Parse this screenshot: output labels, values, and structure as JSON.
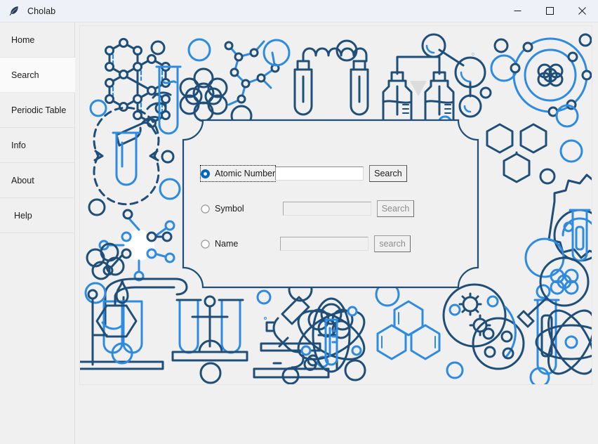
{
  "window": {
    "title": "Cholab",
    "app_icon": "feather-icon",
    "controls": {
      "minimize": "minimize-icon",
      "maximize": "maximize-icon",
      "close": "close-icon"
    }
  },
  "sidebar": {
    "items": [
      {
        "label": "Home",
        "selected": false
      },
      {
        "label": "Search",
        "selected": true
      },
      {
        "label": "Periodic Table",
        "selected": false
      },
      {
        "label": "Info",
        "selected": false
      },
      {
        "label": "About",
        "selected": false
      },
      {
        "label": "Help",
        "selected": false
      }
    ]
  },
  "search_panel": {
    "rows": [
      {
        "radio_label": "Atomic Number",
        "radio_selected": true,
        "radio_focused": true,
        "input_value": "",
        "input_placeholder": "",
        "input_enabled": true,
        "button_label": "Search",
        "button_enabled": true
      },
      {
        "radio_label": "Symbol",
        "radio_selected": false,
        "radio_focused": false,
        "input_value": "",
        "input_placeholder": "",
        "input_enabled": false,
        "button_label": "Search",
        "button_enabled": false
      },
      {
        "radio_label": "Name",
        "radio_selected": false,
        "radio_focused": false,
        "input_value": "",
        "input_placeholder": "",
        "input_enabled": false,
        "button_label": "search",
        "button_enabled": false
      }
    ]
  },
  "theme": {
    "accent_blue": "#0067C0",
    "art_navy": "#1F4E79",
    "art_blue": "#2E8BE0",
    "titlebar_bg": "#EEF1F8",
    "surface_bg": "#F0F0F0",
    "panel_border": "#1F4E79"
  },
  "background_art": {
    "description": "chemistry line-art pattern",
    "motifs": [
      "benzene-ring-cluster-icon",
      "hand-holding-test-tube-icon",
      "molecule-cluster-icon",
      "molecule-ring-icon",
      "coiled-test-tubes-icon",
      "connected-flasks-icon",
      "molecule-node-icon",
      "atom-orbit-icon",
      "rotating-test-tube-icon",
      "star-molecule-icon",
      "triphenyl-icon",
      "gear-test-tube-icon",
      "magnifier-molecule-icon",
      "bubble-circle-icon",
      "burner-flask-icon",
      "test-tube-rack-icon",
      "microscope-icon",
      "atom-thermometer-icon",
      "petri-dish-icon",
      "atom-symbol-icon",
      "test-tube-molecule-icon",
      "poured-test-tubes-icon"
    ]
  }
}
